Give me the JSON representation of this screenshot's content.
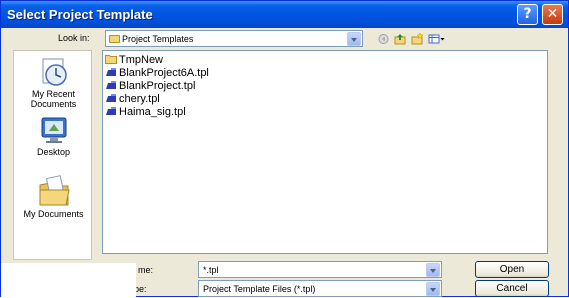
{
  "window": {
    "title": "Select Project Template",
    "help_glyph": "?",
    "close_glyph": "✕"
  },
  "lookin": {
    "label": "Look in:",
    "value": "Project Templates"
  },
  "toolbar": {
    "icons": [
      "back-icon",
      "up-folder-icon",
      "new-folder-icon",
      "view-menu-icon"
    ]
  },
  "places": [
    {
      "label_line1": "My Recent",
      "label_line2": "Documents",
      "icon": "recent-documents-icon"
    },
    {
      "label_line1": "Desktop",
      "label_line2": "",
      "icon": "desktop-icon"
    },
    {
      "label_line1": "My Documents",
      "label_line2": "",
      "icon": "my-documents-icon"
    }
  ],
  "files": [
    {
      "name": "TmpNew",
      "type": "folder"
    },
    {
      "name": "BlankProject6A.tpl",
      "type": "template"
    },
    {
      "name": "BlankProject.tpl",
      "type": "template"
    },
    {
      "name": "chery.tpl",
      "type": "template"
    },
    {
      "name": "Haima_sig.tpl",
      "type": "template"
    }
  ],
  "filename": {
    "label": "me:",
    "value": "*.tpl"
  },
  "filetype": {
    "label": "f type:",
    "value": "Project Template Files (*.tpl)"
  },
  "buttons": {
    "open": "Open",
    "cancel": "Cancel"
  },
  "colors": {
    "titlebar": "#0054e3",
    "dialog_bg": "#ece9d8",
    "border": "#7f9db9"
  }
}
